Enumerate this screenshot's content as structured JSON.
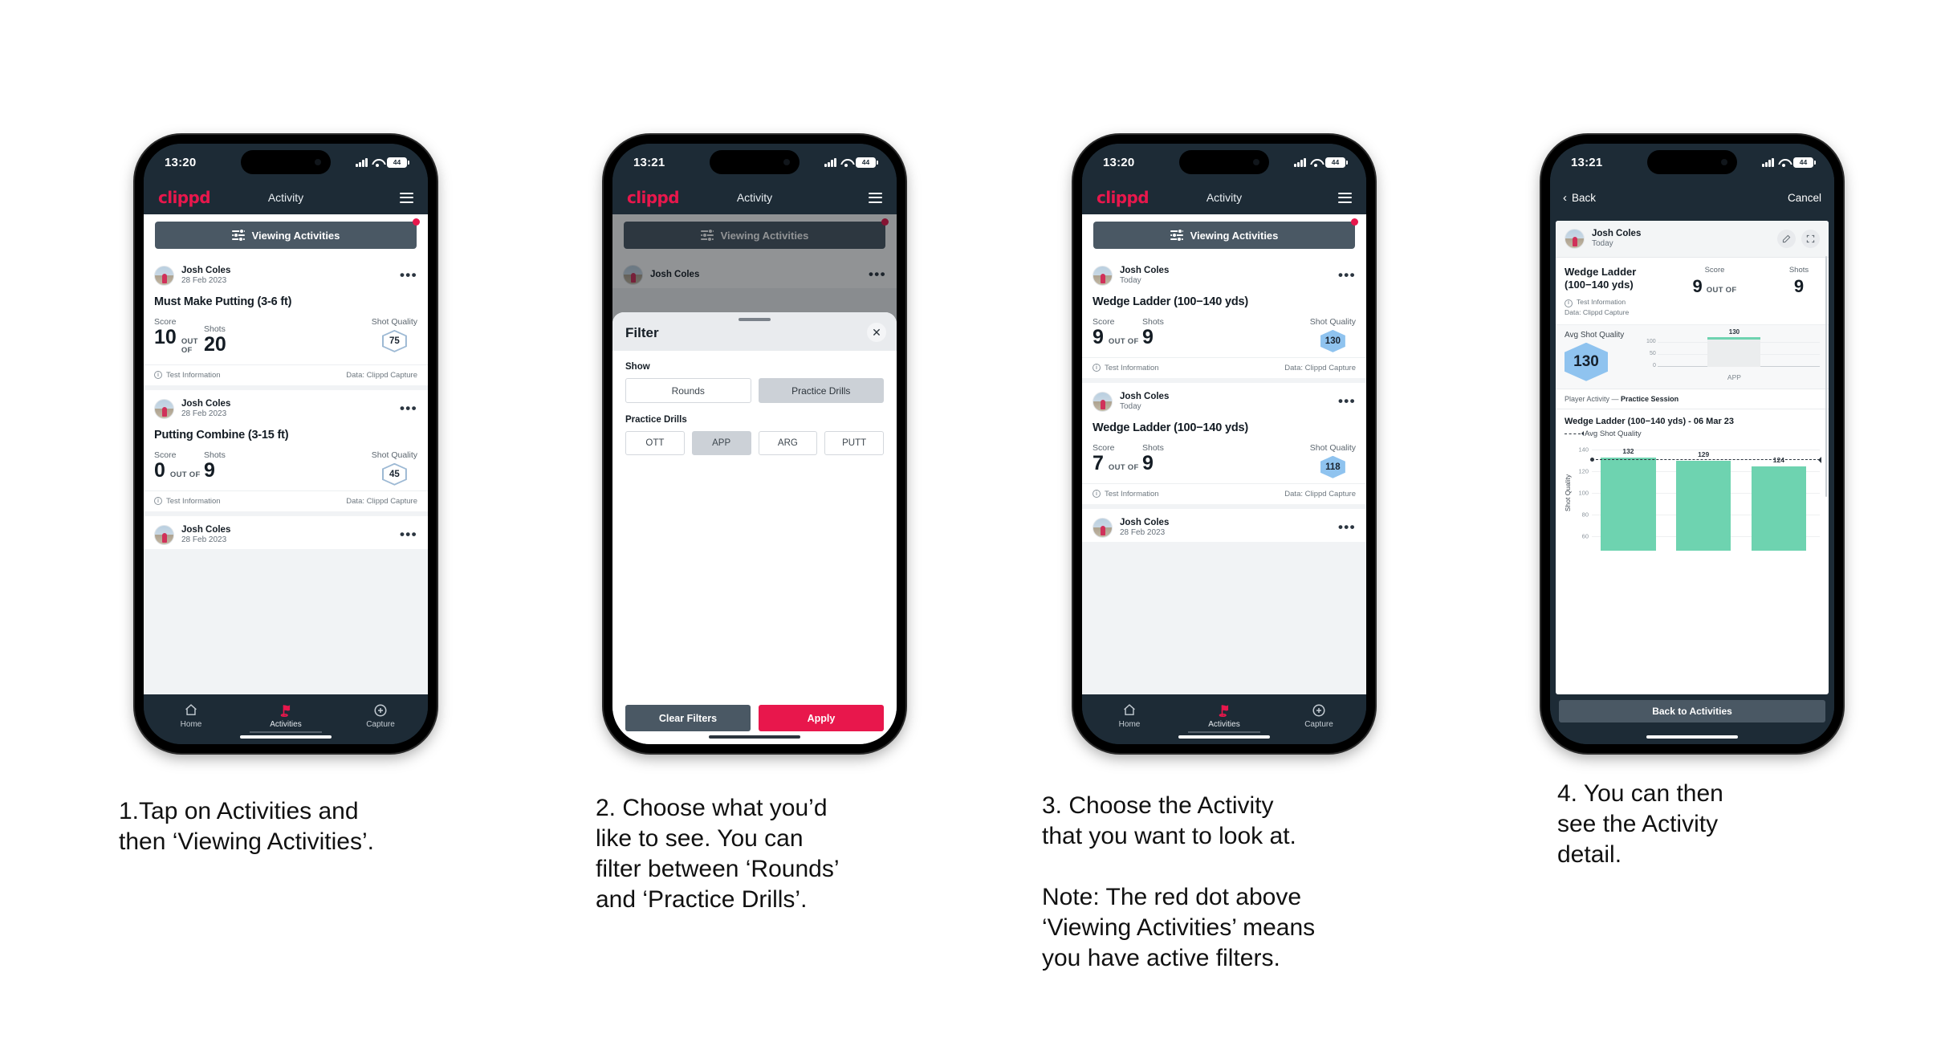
{
  "app": {
    "brand": "clippd",
    "accent": "#e8174c",
    "dark": "#1d2b36",
    "title": "Activity"
  },
  "phones": [
    {
      "status": {
        "time": "13:20",
        "battery": "44"
      },
      "header": {
        "logo": "clippd",
        "title": "Activity",
        "menu_icon": "hamburger-icon"
      },
      "viewing_button": {
        "label": "Viewing Activities",
        "icon": "sliders-icon",
        "has_red_dot": true
      },
      "cards": [
        {
          "user": "Josh Coles",
          "date": "28 Feb 2023",
          "title": "Must Make Putting (3-6 ft)",
          "score_label": "Score",
          "shots_label": "Shots",
          "quality_label": "Shot Quality",
          "score": "10",
          "out_of": "OUT OF",
          "shots": "20",
          "quality": "75",
          "quality_style": "outline",
          "foot_left": "Test Information",
          "foot_right": "Data: Clippd Capture"
        },
        {
          "user": "Josh Coles",
          "date": "28 Feb 2023",
          "title": "Putting Combine (3-15 ft)",
          "score_label": "Score",
          "shots_label": "Shots",
          "quality_label": "Shot Quality",
          "score": "0",
          "out_of": "OUT OF",
          "shots": "9",
          "quality": "45",
          "quality_style": "outline",
          "foot_left": "Test Information",
          "foot_right": "Data: Clippd Capture"
        }
      ],
      "partial_card": {
        "user": "Josh Coles",
        "date": "28 Feb 2023"
      },
      "tabs": [
        {
          "label": "Home",
          "icon": "home-icon",
          "active": false
        },
        {
          "label": "Activities",
          "icon": "golf-flag-icon",
          "active": true
        },
        {
          "label": "Capture",
          "icon": "plus-circle-icon",
          "active": false
        }
      ]
    },
    {
      "status": {
        "time": "13:21",
        "battery": "44"
      },
      "header": {
        "logo": "clippd",
        "title": "Activity",
        "menu_icon": "hamburger-icon"
      },
      "viewing_button": {
        "label": "Viewing Activities",
        "icon": "sliders-icon",
        "has_red_dot": true
      },
      "behind_card": {
        "user": "Josh Coles"
      },
      "modal": {
        "title": "Filter",
        "close_icon": "close-icon",
        "show_label": "Show",
        "show_options": [
          {
            "label": "Rounds",
            "selected": false
          },
          {
            "label": "Practice Drills",
            "selected": true
          }
        ],
        "drills_label": "Practice Drills",
        "drill_options": [
          {
            "label": "OTT",
            "selected": false
          },
          {
            "label": "APP",
            "selected": true
          },
          {
            "label": "ARG",
            "selected": false
          },
          {
            "label": "PUTT",
            "selected": false
          }
        ],
        "clear_label": "Clear Filters",
        "apply_label": "Apply"
      }
    },
    {
      "status": {
        "time": "13:20",
        "battery": "44"
      },
      "header": {
        "logo": "clippd",
        "title": "Activity",
        "menu_icon": "hamburger-icon"
      },
      "viewing_button": {
        "label": "Viewing Activities",
        "icon": "sliders-icon",
        "has_red_dot": true
      },
      "cards": [
        {
          "user": "Josh Coles",
          "date": "Today",
          "title": "Wedge Ladder (100−140 yds)",
          "score_label": "Score",
          "shots_label": "Shots",
          "quality_label": "Shot Quality",
          "score": "9",
          "out_of": "OUT OF",
          "shots": "9",
          "quality": "130",
          "quality_style": "filled",
          "foot_left": "Test Information",
          "foot_right": "Data: Clippd Capture"
        },
        {
          "user": "Josh Coles",
          "date": "Today",
          "title": "Wedge Ladder (100−140 yds)",
          "score_label": "Score",
          "shots_label": "Shots",
          "quality_label": "Shot Quality",
          "score": "7",
          "out_of": "OUT OF",
          "shots": "9",
          "quality": "118",
          "quality_style": "filled",
          "foot_left": "Test Information",
          "foot_right": "Data: Clippd Capture"
        }
      ],
      "partial_card": {
        "user": "Josh Coles",
        "date": "28 Feb 2023"
      },
      "tabs": [
        {
          "label": "Home",
          "icon": "home-icon",
          "active": false
        },
        {
          "label": "Activities",
          "icon": "golf-flag-icon",
          "active": true
        },
        {
          "label": "Capture",
          "icon": "plus-circle-icon",
          "active": false
        }
      ]
    },
    {
      "status": {
        "time": "13:21",
        "battery": "44"
      },
      "navbar": {
        "back": "Back",
        "cancel": "Cancel",
        "back_icon": "chevron-left-icon"
      },
      "detail": {
        "user": "Josh Coles",
        "date": "Today",
        "edit_icon": "pencil-icon",
        "expand_icon": "expand-icon",
        "title": "Wedge Ladder (100−140 yds)",
        "info_line": "Test Information",
        "data_line": "Data: Clippd Capture",
        "score_label": "Score",
        "shots_label": "Shots",
        "score": "9",
        "out_of": "OUT OF",
        "shots": "9",
        "avg_label": "Avg Shot Quality",
        "avg_value": "130",
        "player_activity_prefix": "Player Activity — ",
        "player_activity_value": "Practice Session",
        "chart_title": "Wedge Ladder (100−140 yds) - 06 Mar 23",
        "legend_label": "Avg Shot Quality",
        "back_button": "Back to Activities"
      },
      "chart_data": [
        {
          "type": "bar",
          "title": "Avg Shot Quality",
          "categories": [
            "APP"
          ],
          "values": [
            130
          ],
          "labels": [
            "130"
          ],
          "yticks": [
            0,
            50,
            100
          ],
          "ylim": [
            0,
            140
          ],
          "xlabel": "",
          "ylabel": "",
          "grid": true
        },
        {
          "type": "bar",
          "title": "Wedge Ladder (100−140 yds) - 06 Mar 23",
          "categories": [
            "",
            "",
            ""
          ],
          "values": [
            132,
            129,
            124
          ],
          "labels": [
            "132",
            "129",
            "124"
          ],
          "yticks": [
            60,
            80,
            100,
            120,
            140
          ],
          "ylim": [
            50,
            145
          ],
          "xlabel": "",
          "ylabel": "Shot Quality",
          "legend": [
            "Avg Shot Quality"
          ],
          "avg_line": 131,
          "grid": true,
          "bar_color": "#6ed3b0"
        }
      ]
    }
  ],
  "captions": [
    "1.Tap on Activities and\nthen ‘Viewing Activities’.",
    "2. Choose what you’d\nlike to see. You can\nfilter between ‘Rounds’\nand ‘Practice Drills’.",
    "3. Choose the Activity\nthat you want to look at.\n\nNote: The red dot above\n‘Viewing Activities’ means\nyou have active filters.",
    "4. You can then\nsee the Activity\ndetail."
  ]
}
